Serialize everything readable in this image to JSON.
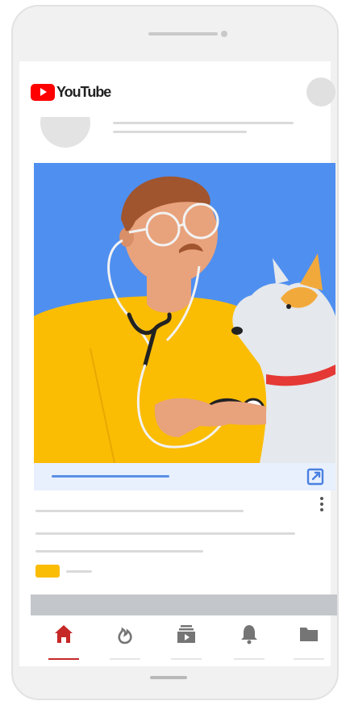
{
  "app": {
    "logo_text": "YouTube"
  },
  "colors": {
    "youtube_red": "#ff0000",
    "media_blue": "#4f8ff0",
    "shirt_yellow": "#fbbc04",
    "collar_red": "#e53935",
    "nav_active": "#c62828",
    "cta_link": "#5b8fe6"
  },
  "icons": {
    "external_link": "external-link-icon",
    "more_vert": "more-vert-icon"
  },
  "bottom_nav": {
    "items": [
      {
        "icon": "home-icon",
        "active": true
      },
      {
        "icon": "trending-icon",
        "active": false
      },
      {
        "icon": "subscriptions-icon",
        "active": false
      },
      {
        "icon": "notifications-icon",
        "active": false
      },
      {
        "icon": "library-icon",
        "active": false
      }
    ]
  }
}
